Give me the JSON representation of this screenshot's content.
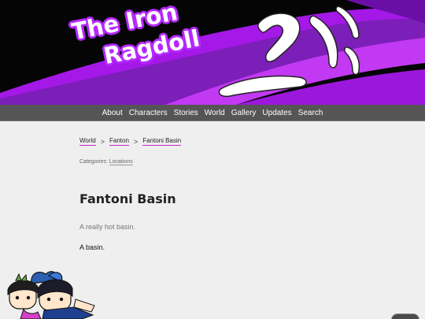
{
  "site": {
    "title_line1": "The Iron",
    "title_line2": "Ragdoll"
  },
  "nav": {
    "items": [
      {
        "label": "About"
      },
      {
        "label": "Characters"
      },
      {
        "label": "Stories"
      },
      {
        "label": "World"
      },
      {
        "label": "Gallery"
      },
      {
        "label": "Updates"
      },
      {
        "label": "Search"
      }
    ]
  },
  "breadcrumb": {
    "items": [
      "World",
      "Fanton",
      "Fantoni Basin"
    ],
    "separator": ">"
  },
  "categories": {
    "label": "Categories:",
    "value": "Locations"
  },
  "page": {
    "title": "Fantoni Basin",
    "subtitle": "A really hot basin.",
    "body": "A basin."
  },
  "colors": {
    "accent": "#b629ff",
    "nav_bg": "#555555",
    "banner_bg": "#050505",
    "link_underline": "#c22cc9"
  }
}
